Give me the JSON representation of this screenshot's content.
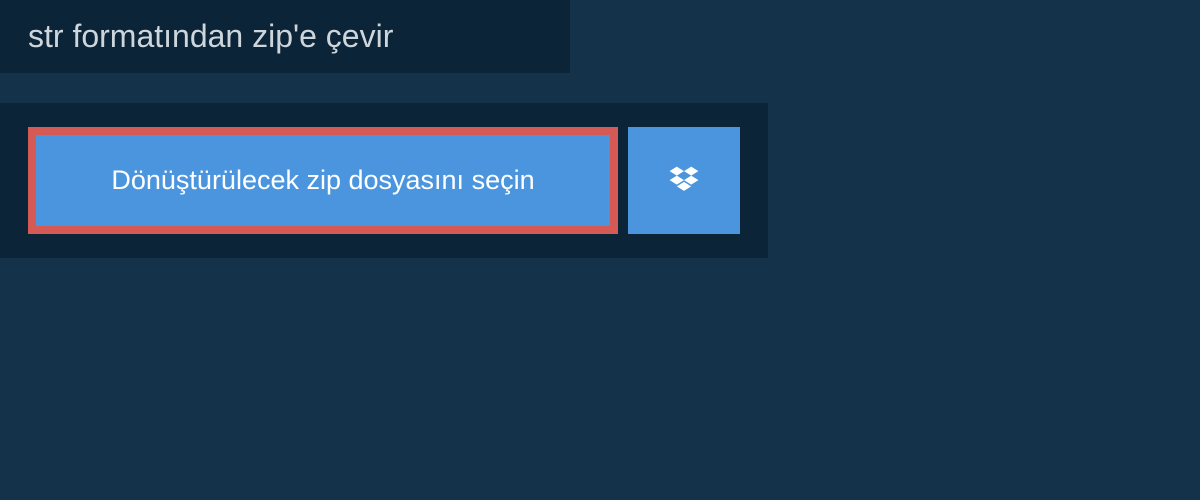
{
  "header": {
    "title": "str formatından zip'e çevir"
  },
  "main": {
    "select_file_label": "Dönüştürülecek zip dosyasını seçin"
  },
  "colors": {
    "background": "#14334a",
    "panel": "#0c2438",
    "button": "#4a95dd",
    "button_border": "#d55a56",
    "text_light": "#cdd6dc",
    "text_white": "#ffffff"
  }
}
